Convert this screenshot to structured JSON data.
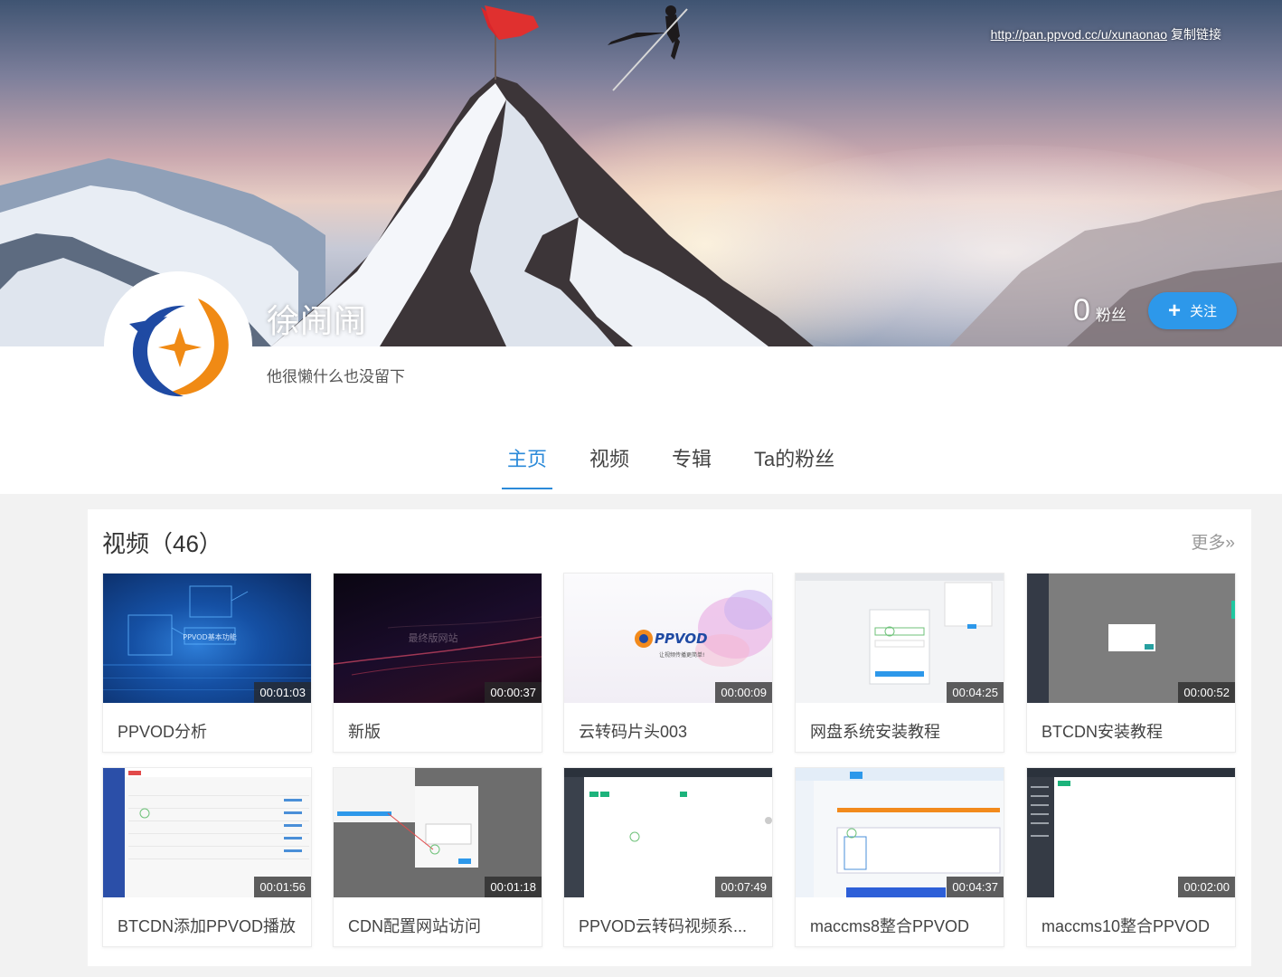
{
  "banner": {
    "share_url": "http://pan.ppvod.cc/u/xunaonao",
    "copy_link_label": "复制链接"
  },
  "user": {
    "name": "徐闹闹",
    "bio": "他很懒什么也没留下",
    "fans_count": "0",
    "fans_label": "粉丝",
    "follow_label": "关注"
  },
  "tabs": [
    {
      "label": "主页",
      "active": true
    },
    {
      "label": "视频",
      "active": false
    },
    {
      "label": "专辑",
      "active": false
    },
    {
      "label": "Ta的粉丝",
      "active": false
    }
  ],
  "videos_section": {
    "title": "视频（46）",
    "more_label": "更多»"
  },
  "videos": [
    {
      "title": "PPVOD分析",
      "duration": "00:01:03"
    },
    {
      "title": "新版",
      "duration": "00:00:37"
    },
    {
      "title": "云转码片头003",
      "duration": "00:00:09"
    },
    {
      "title": "网盘系统安装教程",
      "duration": "00:04:25"
    },
    {
      "title": "BTCDN安装教程",
      "duration": "00:00:52"
    },
    {
      "title": "BTCDN添加PPVOD播放",
      "duration": "00:01:56"
    },
    {
      "title": "CDN配置网站访问",
      "duration": "00:01:18"
    },
    {
      "title": "PPVOD云转码视频系...",
      "duration": "00:07:49"
    },
    {
      "title": "maccms8整合PPVOD",
      "duration": "00:04:37"
    },
    {
      "title": "maccms10整合PPVOD",
      "duration": "00:02:00"
    }
  ],
  "thumb_text": {
    "t1_label": "PPVOD基本功能",
    "t2_label": "最终版网站",
    "t3_logo": "PPVOD",
    "t3_slogan": "让视频传播更简单!"
  },
  "colors": {
    "accent": "#2b8ad9",
    "follow_button": "#2d98ea"
  }
}
